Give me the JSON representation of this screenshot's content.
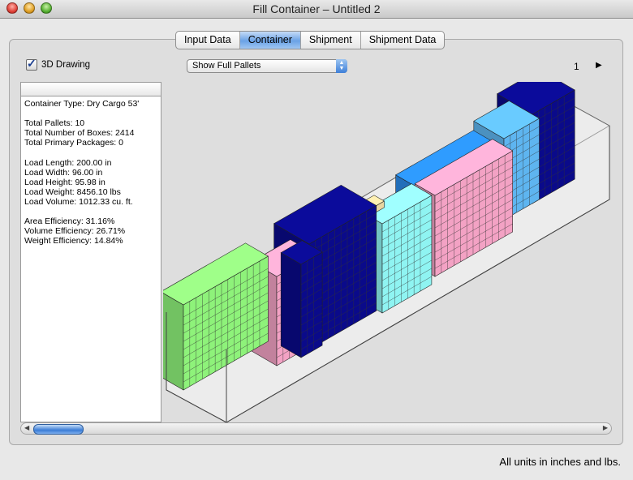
{
  "window": {
    "title": "Fill Container – Untitled 2"
  },
  "tabs": [
    "Input Data",
    "Container",
    "Shipment",
    "Shipment Data"
  ],
  "active_tab": "Container",
  "controls": {
    "drawing_3d_label": "3D Drawing",
    "drawing_3d_checked": true,
    "view_select": "Show Full Pallets",
    "page_number": "1"
  },
  "info": {
    "lines": [
      "Container Type: Dry Cargo 53'",
      "",
      "Total Pallets: 10",
      "Total Number of Boxes: 2414",
      "Total Primary Packages: 0",
      "",
      "Load Length: 200.00 in",
      "Load Width: 96.00 in",
      "Load Height: 95.98 in",
      "Load Weight: 8456.10 lbs",
      "Load Volume: 1012.33 cu. ft.",
      "",
      "Area Efficiency: 31.16%",
      "Volume Efficiency: 26.71%",
      "Weight Efficiency: 14.84%"
    ]
  },
  "footer": {
    "units_note": "All units in inches and lbs."
  },
  "colors": {
    "green": "#8ef27a",
    "pink": "#f3a2c4",
    "dark_blue": "#0a0a8a",
    "cyan": "#8ff4f2",
    "light_blue": "#2a8be8",
    "sky": "#5eb5f0",
    "tan": "#e8d6a0"
  }
}
